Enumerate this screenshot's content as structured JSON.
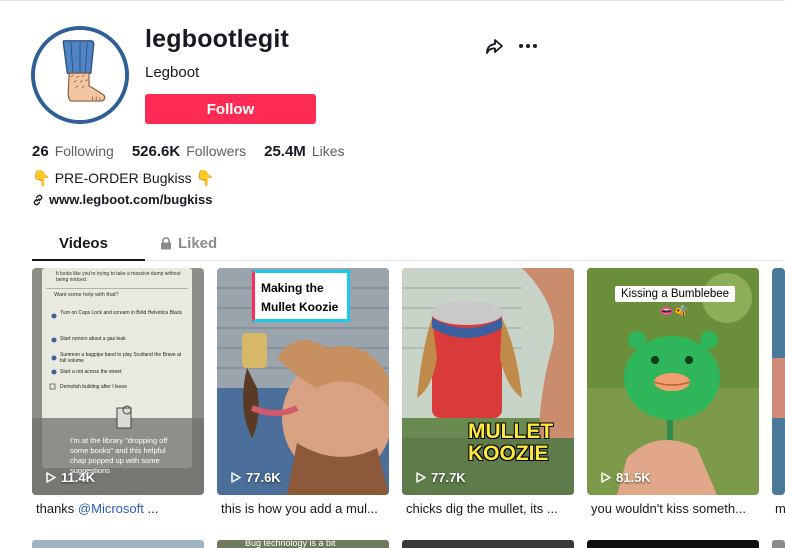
{
  "profile": {
    "username": "legbootlegit",
    "nickname": "Legboot",
    "follow_label": "Follow",
    "stats": [
      {
        "value": "26",
        "label": "Following"
      },
      {
        "value": "526.6K",
        "label": "Followers"
      },
      {
        "value": "25.4M",
        "label": "Likes"
      }
    ],
    "bio": "PRE-ORDER Bugkiss",
    "link": "www.legboot.com/bugkiss"
  },
  "icons": {
    "share": "share-icon",
    "more": "more-icon",
    "link": "link-icon",
    "lock": "lock-icon",
    "play": "play-icon"
  },
  "tabs": [
    {
      "label": "Videos",
      "active": true
    },
    {
      "label": "Liked",
      "active": false
    }
  ],
  "videos": [
    {
      "views": "11.4K",
      "caption_prefix": "thanks ",
      "caption_mention": "@Microsoft",
      "caption_suffix": " ...",
      "screen_text": {
        "header": "It looks like you're trying to take a massive dump without being noticed.",
        "prompt": "Want some help with that?",
        "items": [
          "Turn on Caps Lock and scream in Bold Helvetica Black",
          "Start rumors about a gas leak",
          "Summon a bagpipe band to play Scotland the Brave at full volume",
          "Start a riot across the street"
        ],
        "checkbox": "Demolish building after I leave",
        "subtitle": "I'm at the library \"dropping off some books\" and this helpful chap popped up with some suggestions"
      }
    },
    {
      "views": "77.6K",
      "caption": "this is how you add a mul...",
      "overlay": "Making the Mullet Koozie"
    },
    {
      "views": "77.7K",
      "caption": "chicks dig the mullet, its ...",
      "overlay": "MULLET KOOZIE"
    },
    {
      "views": "81.5K",
      "caption": "you wouldn't kiss someth...",
      "overlay": "Kissing a Bumblebee"
    }
  ],
  "partial_caption": "m",
  "next_row_partial_text": "Bug technology is a bit",
  "colors": {
    "follow": "#fe2c55",
    "avatar_ring": "#2f5f96",
    "mention": "#2b5db9",
    "text_secondary": "#5e5f66",
    "tab_inactive": "#8a8b91"
  }
}
